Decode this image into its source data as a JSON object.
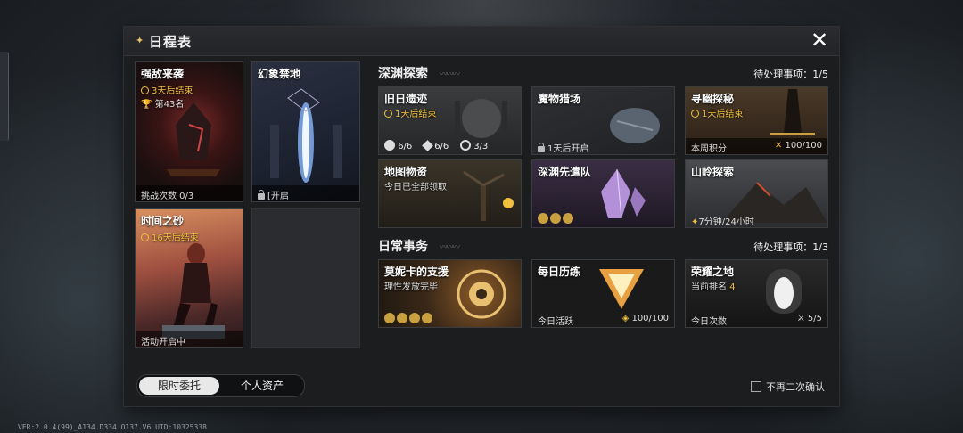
{
  "app": {
    "version": "VER:2.0.4(99)_A134.D334.O137.V6   UID:10325338"
  },
  "panel": {
    "title": "日程表",
    "close_icon": "close-icon"
  },
  "left_cards": {
    "qiangdi": {
      "name": "强敌来袭",
      "time": "3天后结束",
      "rank": "第43名",
      "footer": "挑战次数 0/3"
    },
    "huanxiang": {
      "name": "幻象禁地",
      "footer": "[开启"
    },
    "shijian": {
      "name": "时间之砂",
      "time": "16天后结束",
      "footer": "活动开启中"
    }
  },
  "abyss": {
    "title": "深渊探索",
    "pending": "待处理事项：1/5",
    "cards": {
      "jiuri": {
        "name": "旧日遗迹",
        "time": "1天后结束",
        "stats": [
          "6/6",
          "6/6",
          "3/3"
        ]
      },
      "mowu": {
        "name": "魔物猎场",
        "footer": "1天后开启"
      },
      "xunyou": {
        "name": "寻幽探秘",
        "time": "1天后结束",
        "footer_left": "本周积分",
        "footer_right": "100/100"
      },
      "ditu": {
        "name": "地图物资",
        "sub": "今日已全部领取"
      },
      "xiandui": {
        "name": "深渊先遣队"
      },
      "shanling": {
        "name": "山岭探索",
        "footer": "7分钟/24小时"
      }
    }
  },
  "daily": {
    "title": "日常事务",
    "pending": "待处理事项：1/3",
    "cards": {
      "moni": {
        "name": "莫妮卡的支援",
        "sub": "理性发放完毕"
      },
      "meiri": {
        "name": "每日历练",
        "footer_left": "今日活跃",
        "footer_right": "100/100"
      },
      "rongyao": {
        "name": "荣耀之地",
        "rank_label": "当前排名",
        "rank_value": "4",
        "footer_left": "今日次数",
        "footer_right": "5/5"
      }
    }
  },
  "tabs": [
    "限时委托",
    "个人资产"
  ],
  "confirm_label": "不再二次确认",
  "colors": {
    "accent_gold": "#f0c040",
    "panel_bg": "#1c1d1f"
  }
}
